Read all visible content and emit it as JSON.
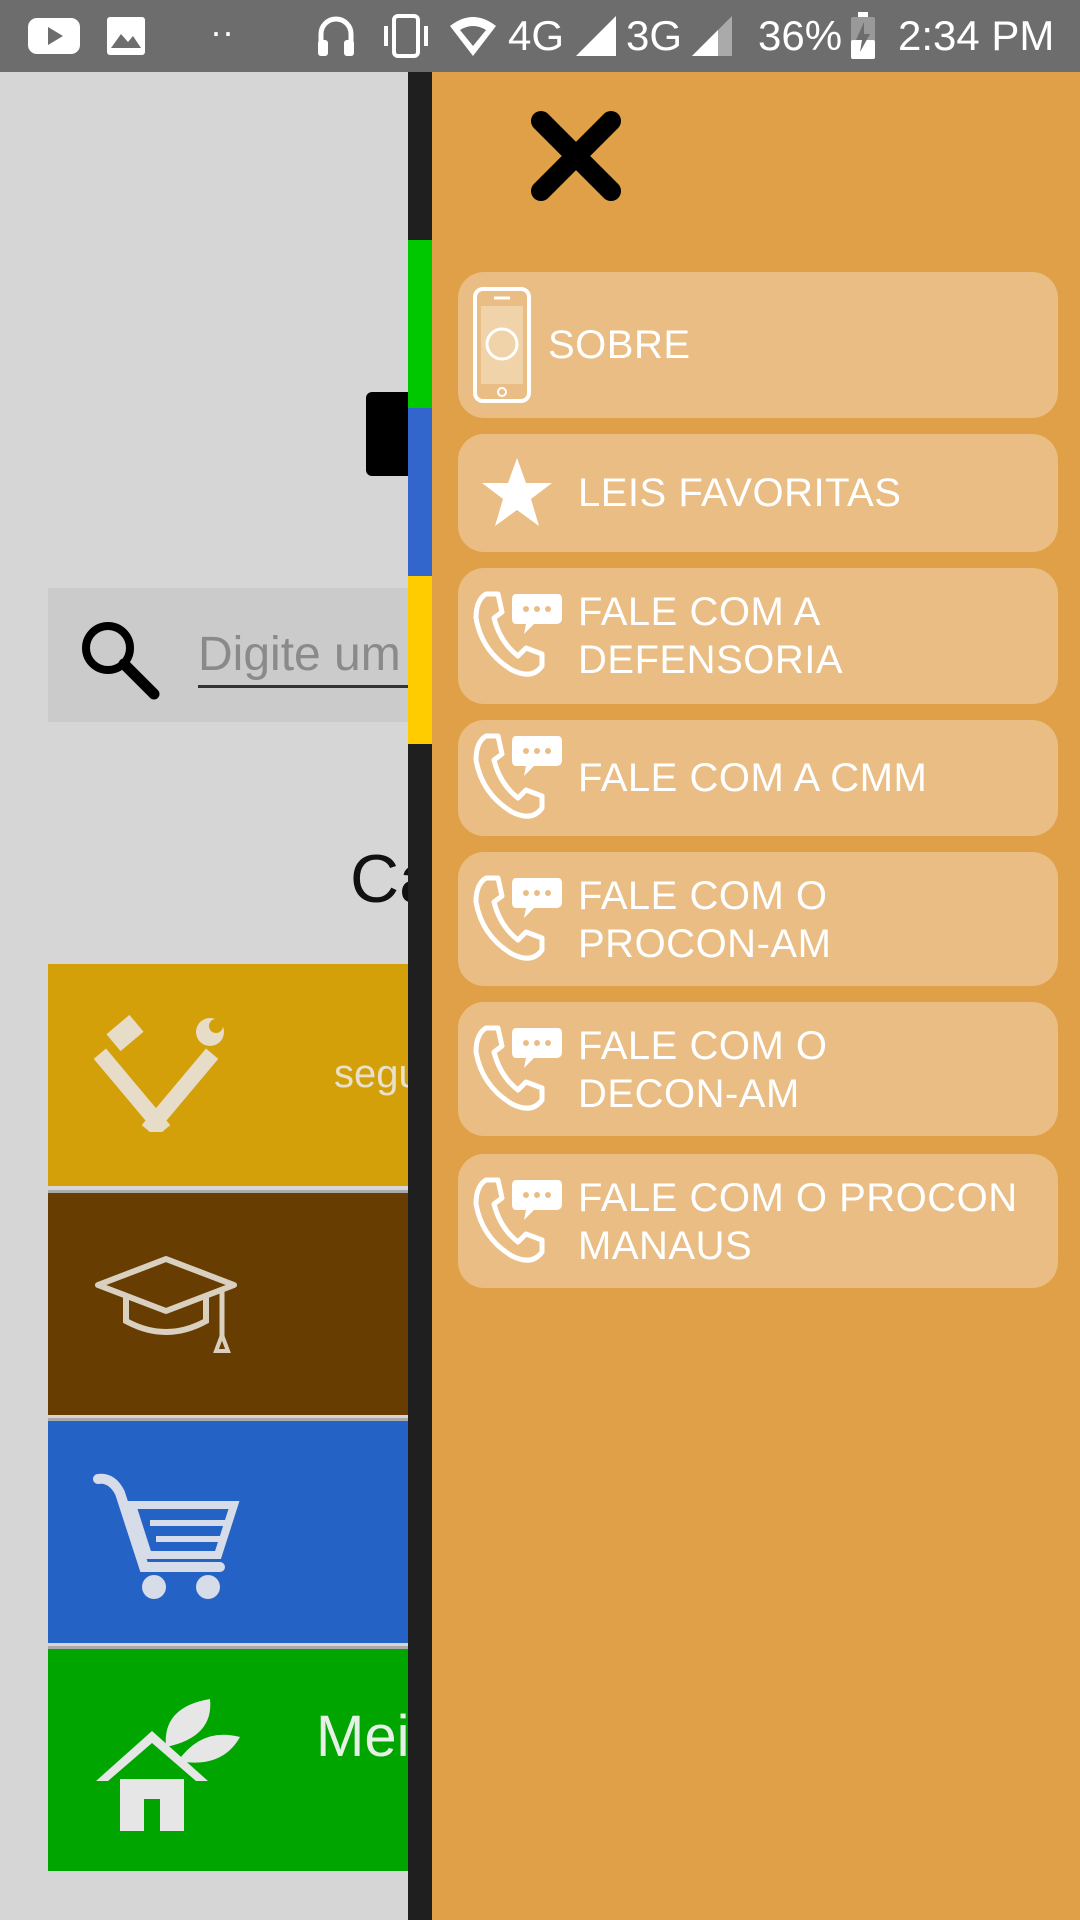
{
  "status_bar": {
    "network_4g": "4G",
    "network_3g": "3G",
    "battery": "36%",
    "time": "2:34 PM",
    "icons": [
      "youtube-icon",
      "image-icon",
      "more-dots-icon",
      "headphones-icon",
      "vibrate-icon",
      "wifi-icon",
      "signal-icon",
      "battery-icon"
    ]
  },
  "background": {
    "search_placeholder": "Digite um",
    "section_heading": "Ca",
    "categories": [
      {
        "label": "segu",
        "color": "#d4a00a",
        "icon": "tools-icon"
      },
      {
        "label": "",
        "color": "#673d02",
        "icon": "graduation-cap-icon"
      },
      {
        "label": "",
        "color": "#2462c6",
        "icon": "shopping-cart-icon"
      },
      {
        "label": "Mei",
        "color": "#00a500",
        "icon": "eco-house-icon"
      }
    ],
    "edge_colors": [
      "#00c800",
      "#3366cc",
      "#ffcc00"
    ]
  },
  "drawer": {
    "background": "#e0a048",
    "item_background": "#e9bd83",
    "items": [
      {
        "label": "SOBRE",
        "icon": "phone-device-icon"
      },
      {
        "label": "LEIS FAVORITAS",
        "icon": "star-icon"
      },
      {
        "label": "FALE COM A DEFENSORIA",
        "icon": "phone-chat-icon"
      },
      {
        "label": "FALE COM A CMM",
        "icon": "phone-chat-icon"
      },
      {
        "label": "FALE COM O PROCON-AM",
        "icon": "phone-chat-icon"
      },
      {
        "label": "FALE COM O DECON-AM",
        "icon": "phone-chat-icon"
      },
      {
        "label": "FALE COM O PROCON MANAUS",
        "icon": "phone-chat-icon"
      }
    ]
  }
}
